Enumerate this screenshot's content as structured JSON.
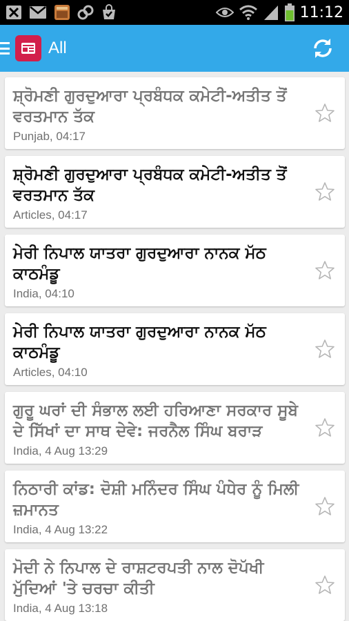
{
  "status_bar": {
    "time": "11:12",
    "icons": [
      "close-box-icon",
      "gmail-icon",
      "app-thumbnail-icon",
      "link-icon",
      "shopping-bag-icon",
      "eye-icon",
      "wifi-icon",
      "signal-icon",
      "battery-icon"
    ]
  },
  "app_bar": {
    "title": "All",
    "refresh_icon": "refresh-icon",
    "menu_icon": "menu-icon"
  },
  "colors": {
    "app_bar": "#33a9e9",
    "logo": "#d21f4b",
    "read_title": "#757575",
    "unread_title": "#111111"
  },
  "articles": [
    {
      "title": "ਸ਼੍ਰੋਮਣੀ ਗੁਰਦੁਆਰਾ ਪ੍ਰਬੰਧਕ ਕਮੇਟੀ-ਅਤੀਤ ਤੋਂ ਵਰਤਮਾਨ ਤੱਕ",
      "meta": "Punjab, 04:17",
      "read": true
    },
    {
      "title": "ਸ਼੍ਰੋਮਣੀ ਗੁਰਦੁਆਰਾ ਪ੍ਰਬੰਧਕ ਕਮੇਟੀ-ਅਤੀਤ ਤੋਂ ਵਰਤਮਾਨ ਤੱਕ",
      "meta": "Articles, 04:17",
      "read": false
    },
    {
      "title": "ਮੇਰੀ ਨਿਪਾਲ ਯਾਤਰਾ ਗੁਰਦੁਆਰਾ ਨਾਨਕ ਮੱਠ ਕਾਠਮੰਡੂ",
      "meta": "India, 04:10",
      "read": false
    },
    {
      "title": "ਮੇਰੀ ਨਿਪਾਲ ਯਾਤਰਾ ਗੁਰਦੁਆਰਾ ਨਾਨਕ ਮੱਠ ਕਾਠਮੰਡੂ",
      "meta": "Articles, 04:10",
      "read": false
    },
    {
      "title": "ਗੁਰੂ ਘਰਾਂ ਦੀ ਸੰਭਾਲ ਲਈ ਹਰਿਆਣਾ ਸਰਕਾਰ ਸੂਬੇ ਦੇ ਸਿੱਖਾਂ ਦਾ ਸਾਥ ਦੇਵੇ: ਜਰਨੈਲ ਸਿੰਘ ਬਰਾੜ",
      "meta": "India, 4 Aug 13:29",
      "read": true
    },
    {
      "title": "ਨਿਠਾਰੀ ਕਾਂਡ: ਦੋਸ਼ੀ ਮਨਿੰਦਰ ਸਿੰਘ ਪੰਧੇਰ ਨੂੰ ਮਿਲੀ ਜ਼ਮਾਨਤ",
      "meta": "India, 4 Aug 13:22",
      "read": true
    },
    {
      "title": "ਮੋਦੀ ਨੇ ਨਿਪਾਲ ਦੇ ਰਾਸ਼ਟਰਪਤੀ ਨਾਲ ਦੋਪੱਖੀ ਮੁੱਦਿਆਂ 'ਤੇ ਚਰਚਾ ਕੀਤੀ",
      "meta": "India, 4 Aug 13:18",
      "read": true
    }
  ]
}
